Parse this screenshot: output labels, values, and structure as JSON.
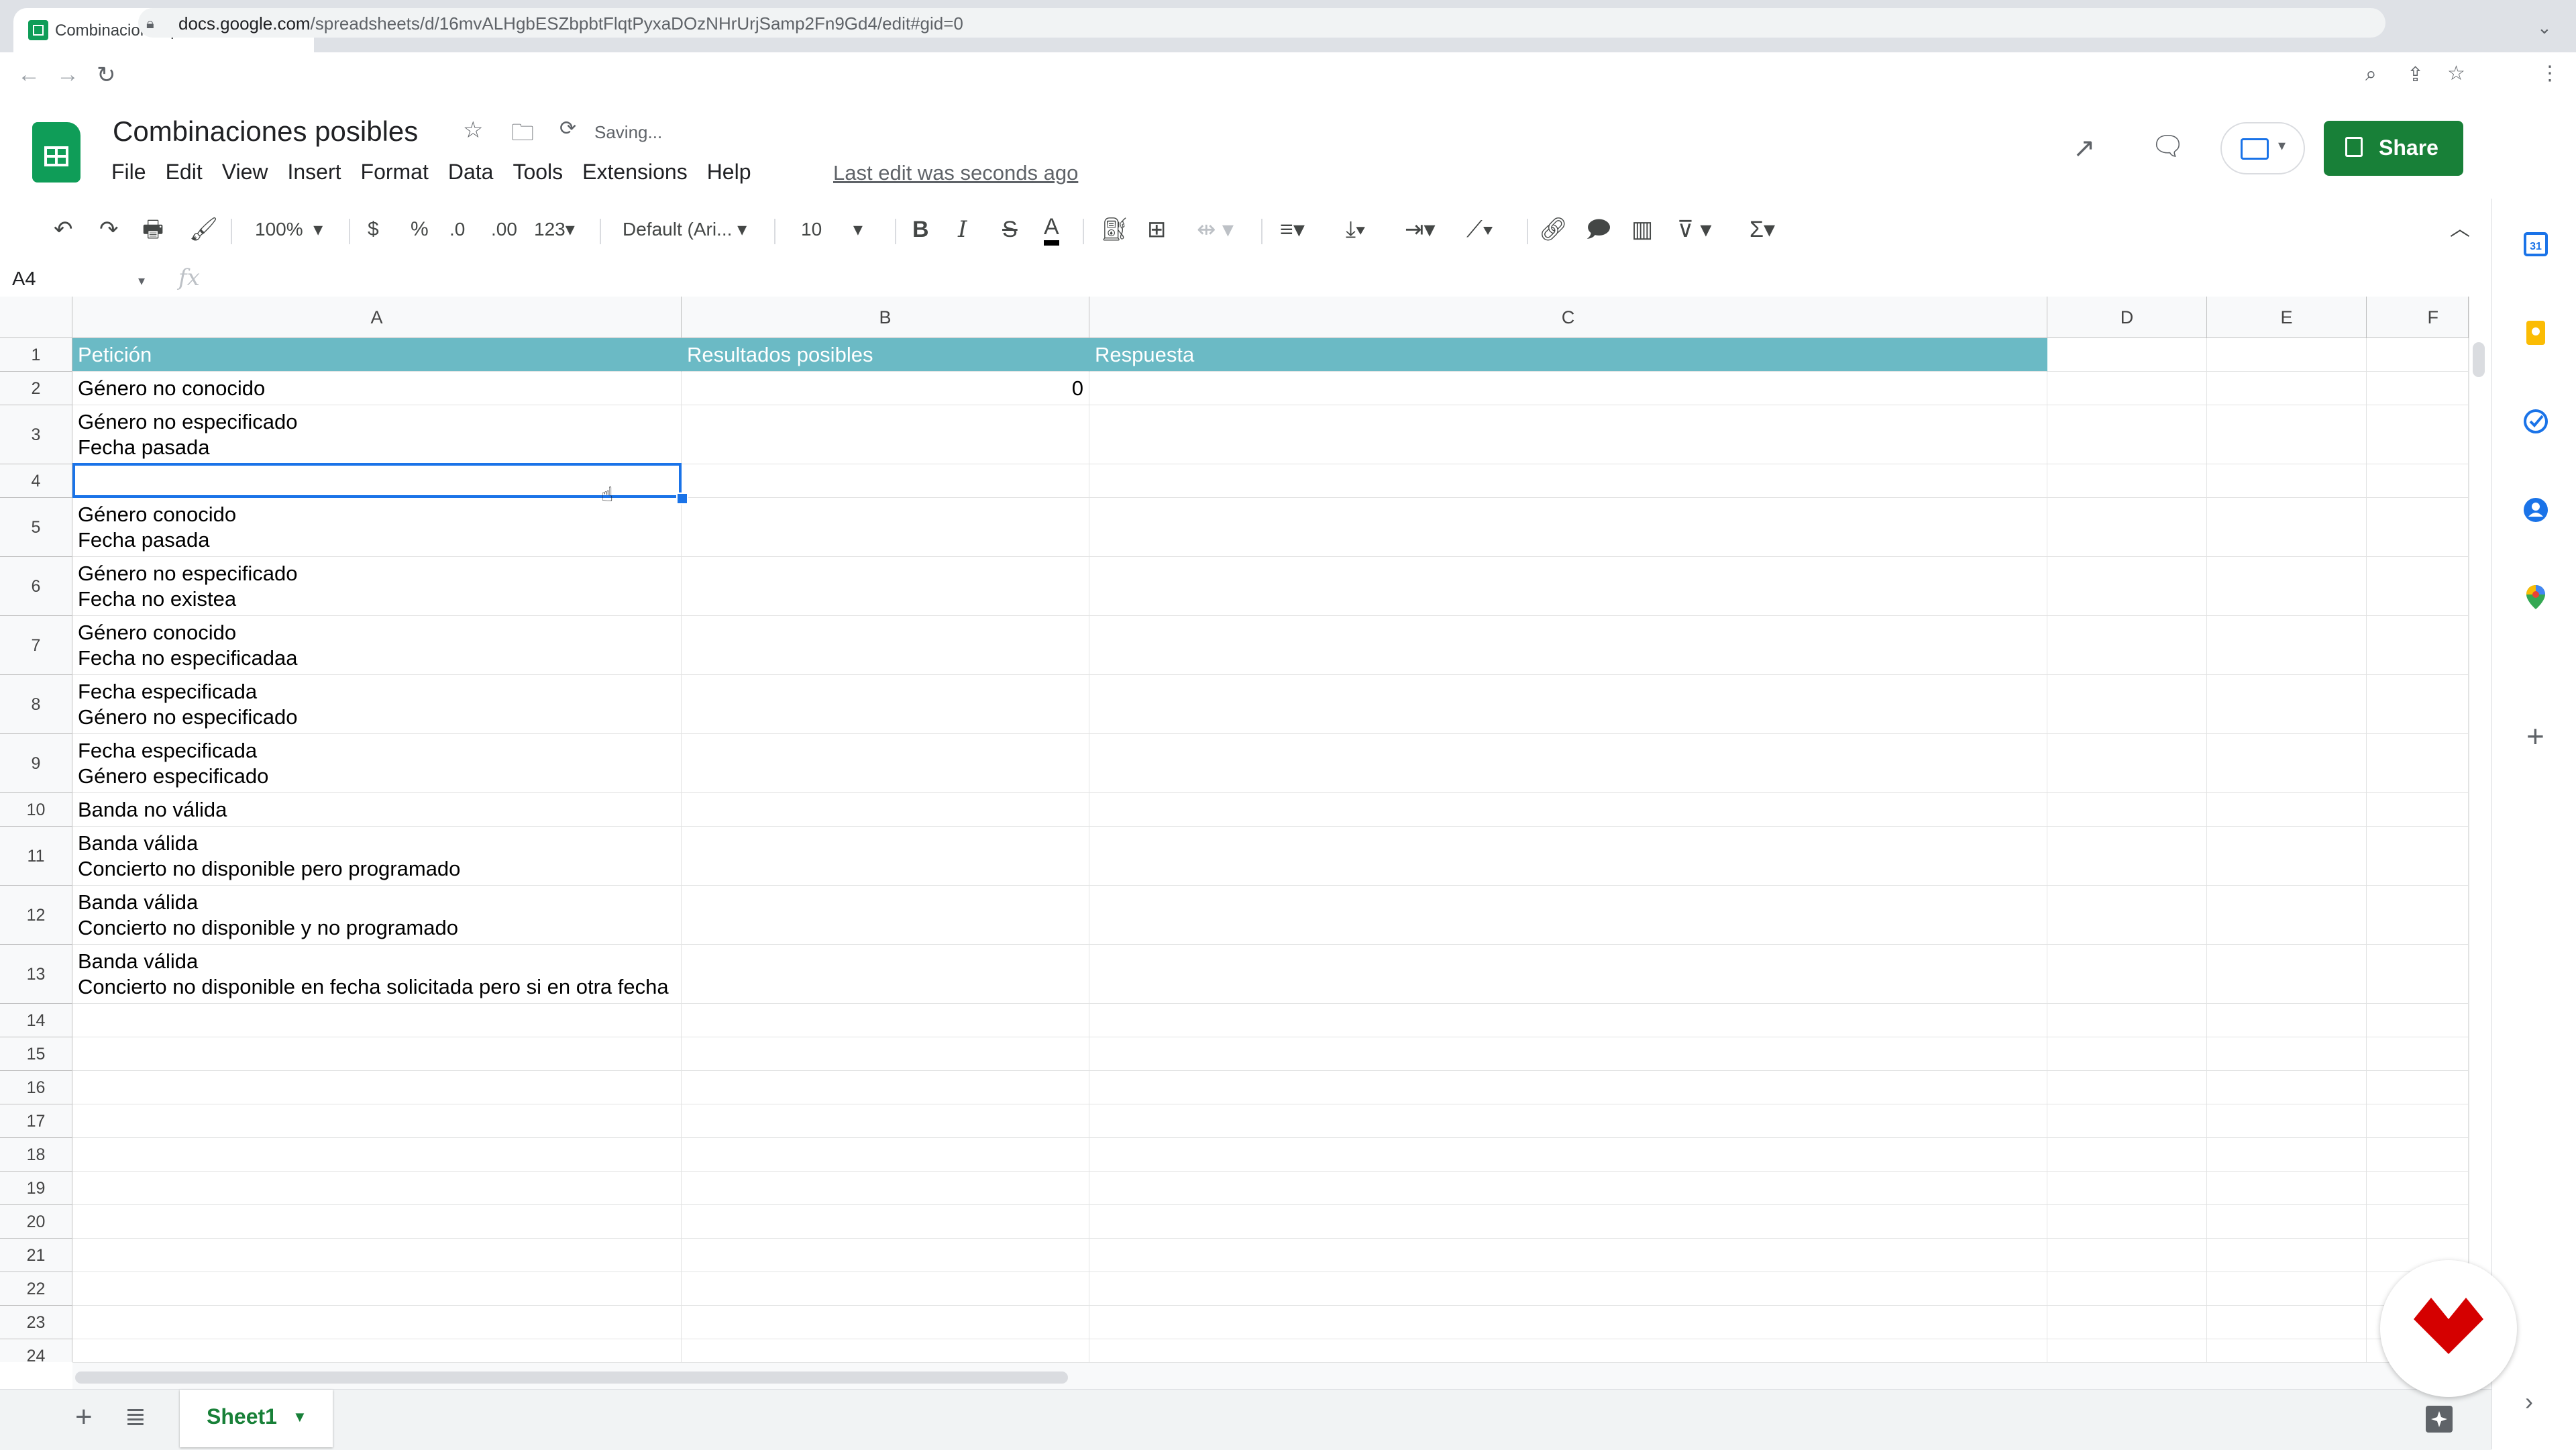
{
  "browser": {
    "tab_title": "Combinaciones posibles - Goo",
    "tab_close": "×",
    "new_tab": "+",
    "url_host": "docs.google.com",
    "url_path": "/spreadsheets/d/16mvALHgbESZbpbtFlqtPyxaDOzNHrUrjSamp2Fn9Gd4/edit#gid=0"
  },
  "doc": {
    "title": "Combinaciones posibles",
    "status": "Saving...",
    "last_edit": "Last edit was seconds ago",
    "share_label": "Share"
  },
  "menu": [
    "File",
    "Edit",
    "View",
    "Insert",
    "Format",
    "Data",
    "Tools",
    "Extensions",
    "Help"
  ],
  "toolbar": {
    "zoom": "100%",
    "currency": "$",
    "percent": "%",
    "dec_decrease": ".0",
    "dec_increase": ".00",
    "more_formats": "123",
    "font": "Default (Ari...",
    "font_size": "10",
    "bold": "B",
    "italic": "I",
    "strike": "S",
    "text_color": "A"
  },
  "formula_bar": {
    "cell_ref": "A4",
    "fx": "fx",
    "value": ""
  },
  "grid": {
    "columns": [
      "A",
      "B",
      "C",
      "D",
      "E",
      "F"
    ],
    "header_color": "#6bbac5",
    "rows": [
      {
        "num": "1",
        "a": "Petición",
        "b": "Resultados posibles",
        "c": "Respuesta"
      },
      {
        "num": "2",
        "a": "Género no conocido",
        "b": "0",
        "c": ""
      },
      {
        "num": "3",
        "a": "Género no especificado\nFecha pasada",
        "b": "",
        "c": ""
      },
      {
        "num": "4",
        "a": "",
        "b": "",
        "c": ""
      },
      {
        "num": "5",
        "a": "Género conocido\nFecha pasada",
        "b": "",
        "c": ""
      },
      {
        "num": "6",
        "a": "Género no especificado\nFecha no existea",
        "b": "",
        "c": ""
      },
      {
        "num": "7",
        "a": "Género conocido\nFecha no especificadaa",
        "b": "",
        "c": ""
      },
      {
        "num": "8",
        "a": "Fecha especificada\nGénero no especificado",
        "b": "",
        "c": ""
      },
      {
        "num": "9",
        "a": "Fecha especificada\nGénero especificado",
        "b": "",
        "c": ""
      },
      {
        "num": "10",
        "a": "Banda no válida",
        "b": "",
        "c": ""
      },
      {
        "num": "11",
        "a": "Banda válida\nConcierto no disponible pero programado",
        "b": "",
        "c": ""
      },
      {
        "num": "12",
        "a": "Banda válida\nConcierto no disponible y no programado",
        "b": "",
        "c": ""
      },
      {
        "num": "13",
        "a": "Banda válida\nConcierto no disponible en fecha solicitada pero si en otra fecha",
        "b": "",
        "c": ""
      },
      {
        "num": "14",
        "a": "",
        "b": "",
        "c": ""
      },
      {
        "num": "15",
        "a": "",
        "b": "",
        "c": ""
      },
      {
        "num": "16",
        "a": "",
        "b": "",
        "c": ""
      },
      {
        "num": "17",
        "a": "",
        "b": "",
        "c": ""
      },
      {
        "num": "18",
        "a": "",
        "b": "",
        "c": ""
      },
      {
        "num": "19",
        "a": "",
        "b": "",
        "c": ""
      },
      {
        "num": "20",
        "a": "",
        "b": "",
        "c": ""
      },
      {
        "num": "21",
        "a": "",
        "b": "",
        "c": ""
      },
      {
        "num": "22",
        "a": "",
        "b": "",
        "c": ""
      },
      {
        "num": "23",
        "a": "",
        "b": "",
        "c": ""
      },
      {
        "num": "24",
        "a": "",
        "b": "",
        "c": ""
      }
    ],
    "selected_cell": "A4"
  },
  "sheets": {
    "add": "+",
    "active_tab": "Sheet1"
  },
  "colors": {
    "share_green": "#188038",
    "selection_blue": "#1a73e8",
    "badge_red": "#d50000"
  }
}
